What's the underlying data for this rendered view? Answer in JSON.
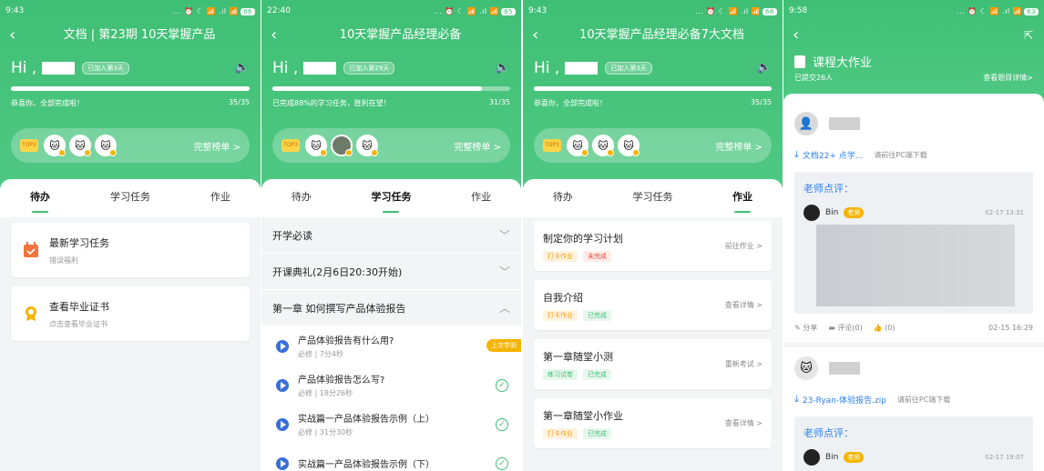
{
  "panels": {
    "p1": {
      "status": {
        "time": "9:43",
        "icons": "... ⏰ ☾ 📶 .ıl 📶",
        "battery": "66"
      },
      "title": "文档 | 第23期    10天掌握产品",
      "hi": "Hi ,",
      "joined": "已加入第3天",
      "progress": {
        "text": "恭喜你，全部完成啦！",
        "count": "35/35",
        "value": 1.0
      },
      "rank_more": "完整榜单 >",
      "tabs": [
        "待办",
        "学习任务",
        "作业"
      ],
      "todos": [
        {
          "title": "最新学习任务",
          "sub": "错误福利"
        },
        {
          "title": "查看毕业证书",
          "sub": "点击查看毕业证书"
        }
      ]
    },
    "p2": {
      "status": {
        "time": "22:40",
        "icons": "... ⏰ ☾ 📶 .ıl 📶",
        "battery": "85"
      },
      "title": "10天掌握产品经理必备",
      "hi": "Hi ,",
      "joined": "已加入第29天",
      "progress": {
        "text": "已完成88%的学习任务，胜利在望！",
        "count": "31/35",
        "value": 0.88
      },
      "rank_more": "完整榜单 >",
      "tabs": [
        "待办",
        "学习任务",
        "作业"
      ],
      "sections": [
        "开学必读",
        "开课典礼(2月6日20:30开始)",
        "第一章 如何撰写产品体验报告"
      ],
      "lessons": [
        {
          "title": "产品体验报告有什么用?",
          "meta": "必修 | 7分4秒",
          "last": "上次学到"
        },
        {
          "title": "产品体验报告怎么写?",
          "meta": "必修 | 18分26秒"
        },
        {
          "title": "实战篇一产品体验报告示例（上）",
          "meta": "必修 | 31分30秒"
        },
        {
          "title": "实战篇一产品体验报告示例（下）",
          "meta": ""
        }
      ]
    },
    "p3": {
      "status": {
        "time": "9:43",
        "icons": "... ⏰ ☾ 📶 .ıl 📶",
        "battery": "66"
      },
      "title": "10天掌握产品经理必备7大文档",
      "hi": "Hi ,",
      "joined": "已加入第3天",
      "progress": {
        "text": "恭喜你，全部完成啦！",
        "count": "35/35",
        "value": 1.0
      },
      "rank_more": "完整榜单 >",
      "tabs": [
        "待办",
        "学习任务",
        "作业"
      ],
      "homeworks": [
        {
          "title": "制定你的学习计划",
          "tag1": "打卡作业",
          "tag2": "未完成",
          "action": "前往作业 >"
        },
        {
          "title": "自我介绍",
          "tag1": "打卡作业",
          "tag2": "已完成",
          "action": "查看详情 >"
        },
        {
          "title": "第一章随堂小测",
          "tag1": "练习试卷",
          "tag2": "已完成",
          "action": "重新考试 >"
        },
        {
          "title": "第一章随堂小作业",
          "tag1": "打卡作业",
          "tag2": "已完成",
          "action": "查看详情 >"
        }
      ]
    },
    "p4": {
      "status": {
        "time": "9:58",
        "icons": "... ⏰ ☾ 📶 .ıl 📶",
        "battery": "63"
      },
      "title": "课程大作业",
      "submitted": "已提交26人",
      "view_detail": "查看题目详情>",
      "posts": [
        {
          "file": "文档22+         点学...",
          "hint": "请前往PC端下载",
          "review_title": "老师点评：",
          "teacher": "Bin",
          "teacher_tag": "老师",
          "review_time": "02-17 13:31",
          "share": "分享",
          "comment": "评论(0)",
          "like": "(0)",
          "time": "02-15 16:29"
        },
        {
          "file": "23-Ryan-体验报告.zip",
          "hint": "请前往PC端下载",
          "review_title": "老师点评：",
          "teacher": "Bin",
          "teacher_tag": "老师",
          "review_time": "02-17 19:07"
        }
      ]
    }
  },
  "colors": {
    "green": "#3fbf75",
    "blue": "#2f80ed",
    "orange": "#f5b400"
  }
}
